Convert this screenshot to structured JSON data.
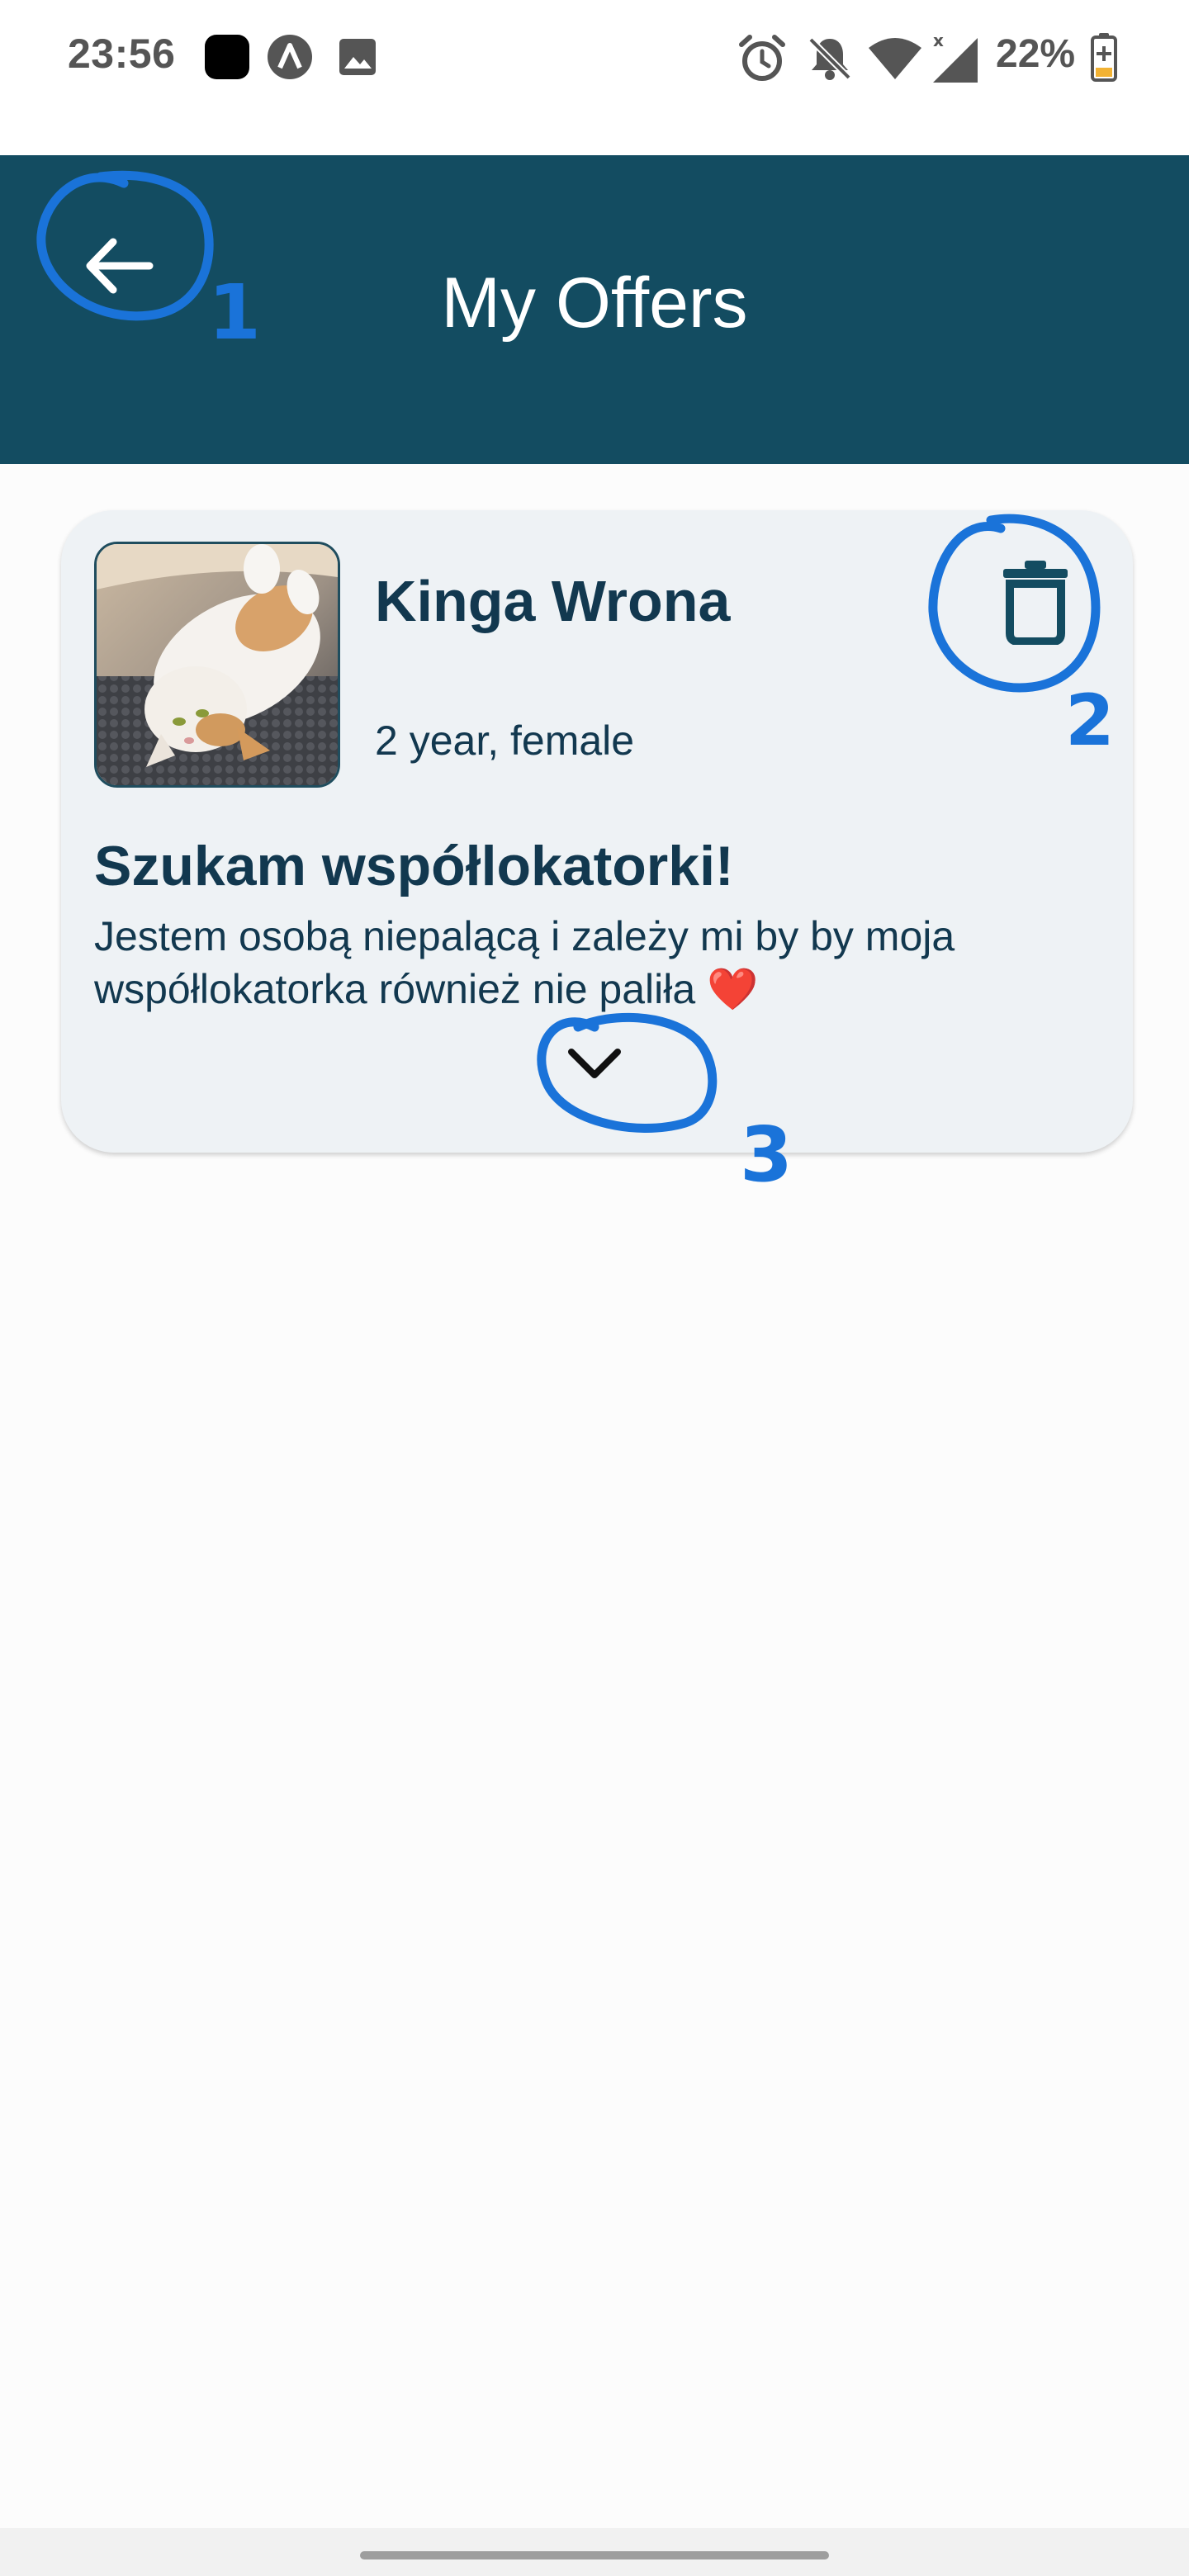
{
  "status_bar": {
    "time": "23:56",
    "battery": "22%",
    "left_icons": [
      "app-square-icon",
      "assistant-icon",
      "gallery-icon"
    ],
    "right_icons": [
      "alarm-icon",
      "muted-bell-icon",
      "wifi-icon",
      "signal-icon",
      "battery-charging-icon"
    ]
  },
  "app_bar": {
    "title": "My Offers",
    "background": "#134c61"
  },
  "offer": {
    "owner_name": "Kinga Wrona",
    "owner_meta": "2 year, female",
    "title": "Szukam współlokatorki!",
    "description": "Jestem osobą niepalącą i zależy mi by by moja współlokatorka również nie paliła ❤️",
    "card_background": "#eef2f5",
    "text_color": "#12384f"
  },
  "annotations": {
    "color": "#1a73d9",
    "labels": [
      "1",
      "2",
      "3"
    ]
  }
}
